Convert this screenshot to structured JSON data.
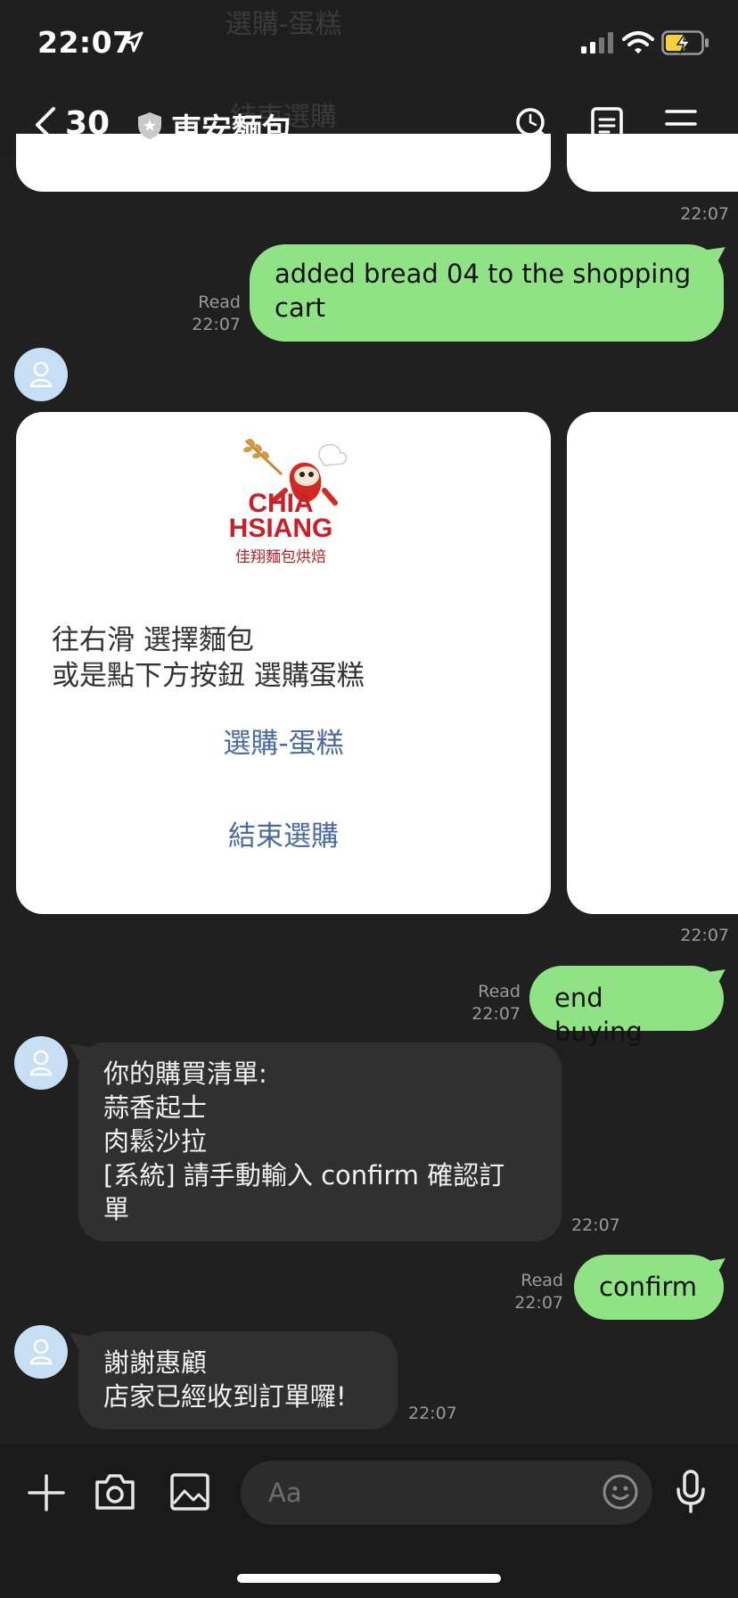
{
  "status": {
    "time": "22:07"
  },
  "header": {
    "back_count": "30",
    "title": "東安麵包"
  },
  "top_ghost": {
    "line1": "選購-蛋糕",
    "line2": "結束選購"
  },
  "messages": {
    "ts_top": "22:07",
    "m1": {
      "text": "added bread 04 to the shopping cart",
      "read": "Read",
      "time": "22:07"
    },
    "card": {
      "logo_line1": "CHIA",
      "logo_line2": "HSIANG",
      "logo_sub": "佳翔麵包烘焙",
      "line1": "往右滑 選擇麵包",
      "line2": "或是點下方按鈕 選購蛋糕",
      "button1": "選購-蛋糕",
      "button2": "結束選購",
      "time": "22:07"
    },
    "m2": {
      "text": "end buying",
      "read": "Read",
      "time": "22:07"
    },
    "m3": {
      "lines": [
        "你的購買清單:",
        "蒜香起士",
        "肉鬆沙拉",
        "[系統] 請手動輸入 confirm 確認訂",
        "單"
      ],
      "time": "22:07"
    },
    "m4": {
      "text": "confirm",
      "read": "Read",
      "time": "22:07"
    },
    "m5": {
      "lines": [
        "謝謝惠顧",
        "店家已經收到訂單囉!"
      ],
      "time": "22:07"
    }
  },
  "input": {
    "placeholder": "Aa"
  },
  "icons": {
    "back": "chevron-left-icon",
    "shield": "shield-star-icon",
    "search": "search-icon",
    "notes": "notes-icon",
    "menu": "menu-icon",
    "add": "plus-icon",
    "camera": "camera-icon",
    "image": "image-icon",
    "emoji": "emoji-icon",
    "mic": "microphone-icon",
    "signal": "signal-icon",
    "wifi": "wifi-icon",
    "battery": "battery-charging-icon",
    "location": "location-arrow-icon",
    "avatar": "user-avatar-icon"
  },
  "colors": {
    "background": "#202020",
    "sent_bubble": "#8fe385",
    "received_bubble": "#303030",
    "card": "#ffffff",
    "link": "#4a6aa0",
    "battery": "#f5d23a"
  }
}
